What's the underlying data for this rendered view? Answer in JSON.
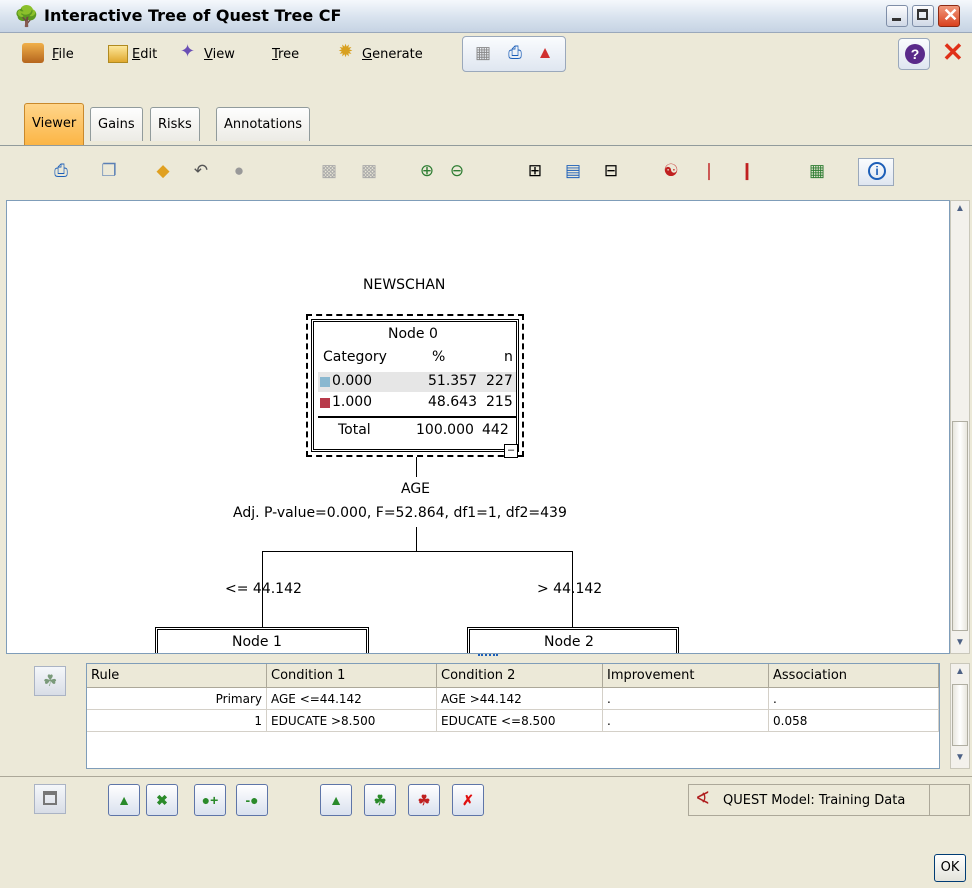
{
  "window": {
    "title": "Interactive Tree of Quest Tree CF"
  },
  "menu": [
    {
      "label": "File",
      "underline": "F",
      "rest": "ile"
    },
    {
      "label": "Edit",
      "underline": "E",
      "rest": "dit"
    },
    {
      "label": "View",
      "underline": "V",
      "rest": "iew"
    },
    {
      "label": "Tree",
      "underline": "T",
      "rest": "ree"
    },
    {
      "label": "Generate",
      "underline": "G",
      "rest": "enerate"
    }
  ],
  "tabs": [
    "Viewer",
    "Gains",
    "Risks",
    "Annotations"
  ],
  "tree": {
    "target": "NEWSCHAN",
    "root": {
      "title": "Node 0",
      "header": {
        "category": "Category",
        "pct": "%",
        "n": "n"
      },
      "rows": [
        {
          "cat": "0.000",
          "pct": "51.357",
          "n": "227",
          "color": "#8ab8d0"
        },
        {
          "cat": "1.000",
          "pct": "48.643",
          "n": "215",
          "color": "#b83a4a"
        }
      ],
      "total": {
        "label": "Total",
        "pct": "100.000",
        "n": "442"
      },
      "collapse": "–"
    },
    "split": {
      "variable": "AGE",
      "stats": "Adj. P-value=0.000, F=52.864, df1=1, df2=439",
      "left_label": "<= 44.142",
      "right_label": "> 44.142"
    },
    "children": [
      "Node 1",
      "Node 2"
    ]
  },
  "surrogates": {
    "columns": [
      "Rule",
      "Condition 1",
      "Condition 2",
      "Improvement",
      "Association"
    ],
    "rows": [
      [
        "Primary",
        "AGE <=44.142",
        "AGE >44.142",
        ".",
        "."
      ],
      [
        "1",
        "EDUCATE >8.500",
        "EDUCATE <=8.500",
        ".",
        "0.058"
      ]
    ]
  },
  "status": {
    "model_label": "QUEST Model: Training Data"
  },
  "ok_label": "OK",
  "colors": {
    "accent_tab": "#fbb545",
    "close": "#d9411e"
  }
}
